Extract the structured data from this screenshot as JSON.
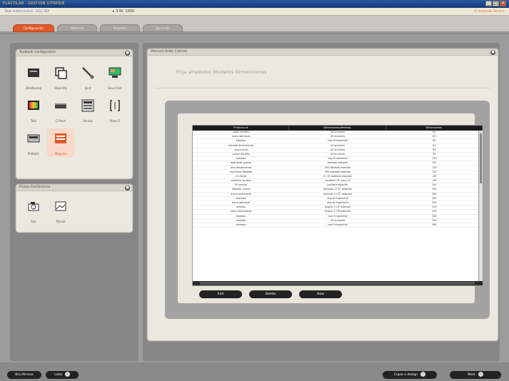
{
  "window": {
    "title": "PLASTILAB  ·  GESTION VITRERIE",
    "minimize": "_",
    "maximize": "□",
    "close": "×"
  },
  "menubar": {
    "path": "Tabla Autoformatuiii  ·  2012 SRP",
    "zoom": "▸ 3 Nr. 1000",
    "right": "© Indicación Servicio"
  },
  "tabs": [
    {
      "label": "Configuración"
    },
    {
      "label": "Selección"
    },
    {
      "label": "Previsión"
    },
    {
      "label": "Ejecución"
    }
  ],
  "tools_panel": {
    "title": "Toolbook Configuration",
    "tools": [
      {
        "label": "Windowing",
        "icon": "window-tool-icon"
      },
      {
        "label": "Objectify",
        "icon": "duplicate-icon"
      },
      {
        "label": "Joint",
        "icon": "brush-icon"
      },
      {
        "label": "Save Fast",
        "icon": "monitor-icon"
      },
      {
        "label": "Text",
        "icon": "color-panel-icon"
      },
      {
        "label": "Cl Pack",
        "icon": "box-icon"
      },
      {
        "label": "Ventas",
        "icon": "calculator-icon"
      },
      {
        "label": "Rows G",
        "icon": "brackets-icon"
      },
      {
        "label": "PhStatic",
        "icon": "printer-icon"
      },
      {
        "label": "Mayoría",
        "icon": "table-icon"
      }
    ]
  },
  "products_panel": {
    "title": "Planos Del/Sistema",
    "tools": [
      {
        "label": "Seo",
        "icon": "camera-icon"
      },
      {
        "label": "Planos",
        "icon": "photo-icon"
      }
    ]
  },
  "main_panel": {
    "title": "Planned Order Cabinet",
    "subtitle": "Elija alrededor Modelos Dimensiones"
  },
  "grid": {
    "columns": [
      "Producto id",
      "Dimensiones/Medidas",
      "Dimensiones"
    ],
    "rows": [
      [
        "cajón bordillo",
        "20 acciones",
        "80"
      ],
      [
        "cerca adicional",
        "20 acciones",
        "80"
      ],
      [
        "baldoso",
        "reja Ornamental",
        "80"
      ],
      [
        "entrada dimensiones",
        "20 acciones",
        "90"
      ],
      [
        "viga ancha",
        "20 acciones",
        "90"
      ],
      [
        "cañon bordillo",
        "20 acciones",
        "90"
      ],
      [
        "baldoso",
        "reja Ornamental",
        "110"
      ],
      [
        "diamante grueso",
        "doblado estación",
        "120"
      ],
      [
        "arco desdenamos",
        "200 doblado estación",
        "120"
      ],
      [
        "escritorio doblado",
        "200 doblado estación",
        "120"
      ],
      [
        "el dibujo",
        "Cl. 20 doblado estación",
        "130"
      ],
      [
        "escalera, gruesa",
        "pantalla CTC arco 20",
        "130"
      ],
      [
        "50 grueso",
        "pantalla estación",
        "140"
      ],
      [
        "doblado, ancho",
        "pantalla 3 CTC estación",
        "150"
      ],
      [
        "arena pavimento",
        "pantalla 3 CTC estación",
        "160"
      ],
      [
        "soportes",
        "ángulo Ingeniería",
        "180"
      ],
      [
        "barra adicional",
        "ángulo Ingeniería",
        "200"
      ],
      [
        "baldoso",
        "ángulo 3 C/P estación",
        "210"
      ],
      [
        "carro desarmable",
        "ángulo 3 C/P estación",
        "220"
      ],
      [
        "baldoso",
        "reja Ornamental",
        "240"
      ],
      [
        "soldado",
        "20 acciones",
        "250"
      ],
      [
        "baldoso",
        "reja Ornamental",
        "260"
      ]
    ]
  },
  "dialog_buttons": {
    "edit": "Edit",
    "delete": "Delete",
    "new": "New"
  },
  "footer": {
    "back_left": "Bra Atrasar",
    "list": "Lista",
    "save_design": "Copia o design",
    "next": "Next"
  }
}
